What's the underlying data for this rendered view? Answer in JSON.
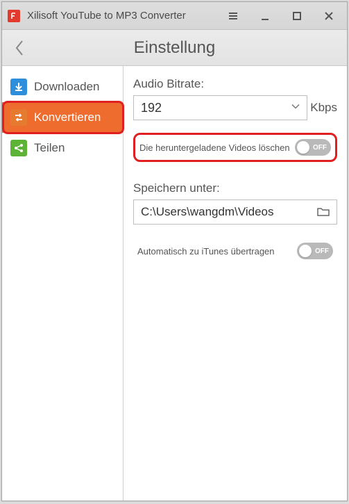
{
  "titlebar": {
    "app_name": "Xilisoft YouTube to MP3 Converter"
  },
  "header": {
    "page_title": "Einstellung"
  },
  "sidebar": {
    "items": [
      {
        "label": "Downloaden"
      },
      {
        "label": "Konvertieren"
      },
      {
        "label": "Teilen"
      }
    ]
  },
  "content": {
    "bitrate_label": "Audio Bitrate:",
    "bitrate_value": "192",
    "bitrate_unit": "Kbps",
    "delete_videos_label": "Die heruntergeladene Videos löschen",
    "delete_videos_state": "OFF",
    "save_to_label": "Speichern unter:",
    "save_to_path": "C:\\Users\\wangdm\\Videos",
    "itunes_label": "Automatisch zu iTunes übertragen",
    "itunes_state": "OFF"
  }
}
